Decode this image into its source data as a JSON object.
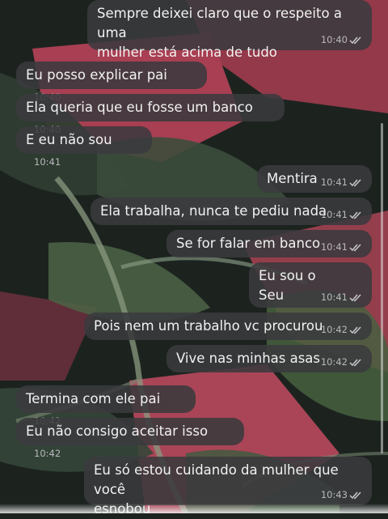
{
  "chat": {
    "messages": [
      {
        "dir": "out",
        "text": "Sempre deixei claro que o respeito a uma\nmulher está acima de tudo",
        "time": "10:40",
        "status": "read"
      },
      {
        "dir": "in",
        "text": "Eu posso explicar pai",
        "time": "10:40"
      },
      {
        "dir": "in",
        "text": "Ela queria que eu fosse um banco",
        "time": "10:40"
      },
      {
        "dir": "in",
        "text": "E eu não sou",
        "time": "10:41"
      },
      {
        "dir": "out",
        "text": "Mentira",
        "time": "10:41",
        "status": "read"
      },
      {
        "dir": "out",
        "text": "Ela trabalha, nunca te pediu nada",
        "time": "10:41",
        "status": "read"
      },
      {
        "dir": "out",
        "text": "Se for falar em banco",
        "time": "10:41",
        "status": "read"
      },
      {
        "dir": "out",
        "text": "Eu sou o\nSeu",
        "time": "10:41",
        "status": "read"
      },
      {
        "dir": "out",
        "text": "Pois nem um trabalho vc procurou",
        "time": "10:42",
        "status": "read"
      },
      {
        "dir": "out",
        "text": "Vive nas minhas asas",
        "time": "10:42",
        "status": "read"
      },
      {
        "dir": "in",
        "text": "Termina com ele pai",
        "time": "10:42"
      },
      {
        "dir": "in",
        "text": "Eu não consigo aceitar isso",
        "time": "10:42"
      },
      {
        "dir": "out",
        "text": "Eu só estou cuidando da mulher que você\nesnobou",
        "time": "10:43",
        "status": "read"
      }
    ]
  },
  "colors": {
    "bubble": "#3a3a3e",
    "text": "#f2f2f2",
    "timestamp": "#b8b8bc",
    "wallpaper_pink": "#c0485e",
    "wallpaper_leaf": "#4f6a4a"
  }
}
